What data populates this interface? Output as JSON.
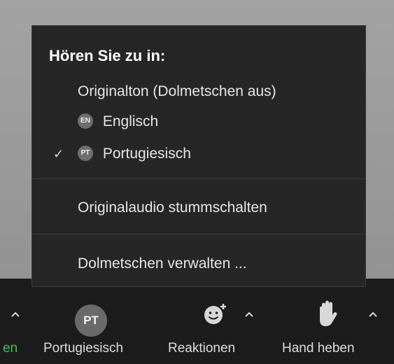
{
  "menu": {
    "title": "Hören Sie zu in:",
    "items": [
      {
        "label": "Originalton (Dolmetschen aus)",
        "badge": ""
      },
      {
        "label": "Englisch",
        "badge": "EN"
      },
      {
        "label": "Portugiesisch",
        "badge": "PT",
        "checked": true
      }
    ],
    "mute_original": "Originalaudio stummschalten",
    "manage": "Dolmetschen verwalten ..."
  },
  "toolbar": {
    "partial_left_label": "en",
    "interpretation": {
      "avatar": "PT",
      "label": "Portugiesisch"
    },
    "reactions": {
      "label": "Reaktionen"
    },
    "raise_hand": {
      "label": "Hand heben"
    }
  },
  "colors": {
    "menu_bg": "#262626",
    "toolbar_bg": "#1c1c1c",
    "accent_green": "#37c35a"
  }
}
